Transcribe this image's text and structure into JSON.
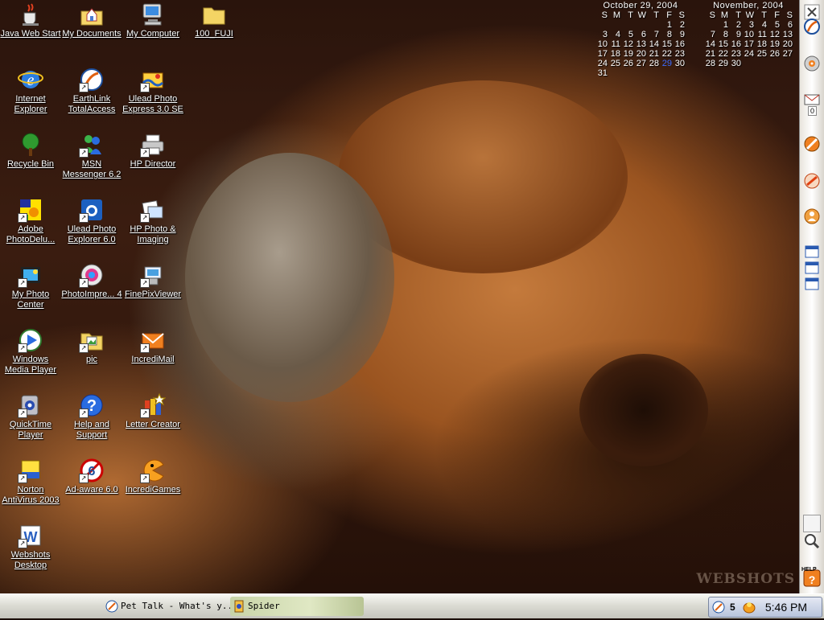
{
  "desktop": {
    "icons": [
      {
        "label": "Java Web Start",
        "icon": "java-cup-icon"
      },
      {
        "label": "My Documents",
        "icon": "house-folder-icon"
      },
      {
        "label": "My Computer",
        "icon": "computer-monitor-icon"
      },
      {
        "label": "100_FUJI",
        "icon": "folder-icon"
      },
      {
        "label": "Internet Explorer",
        "icon": "internet-explorer-icon"
      },
      {
        "label": "EarthLink TotalAccess",
        "icon": "earthlink-icon"
      },
      {
        "label": "Ulead Photo Express 3.0 SE",
        "icon": "photo-express-icon"
      },
      {
        "label": "Recycle Bin",
        "icon": "recycle-bin-tree-icon"
      },
      {
        "label": "MSN Messenger 6.2",
        "icon": "msn-messenger-icon"
      },
      {
        "label": "HP Director",
        "icon": "printer-icon"
      },
      {
        "label": "Adobe PhotoDelu...",
        "icon": "photodeluxe-icon"
      },
      {
        "label": "Ulead Photo Explorer 6.0",
        "icon": "photo-explorer-icon"
      },
      {
        "label": "HP Photo & Imaging",
        "icon": "hp-photo-icon"
      },
      {
        "label": "My Photo Center",
        "icon": "photo-center-icon"
      },
      {
        "label": "PhotoImpre... 4",
        "icon": "photoimpression-icon"
      },
      {
        "label": "FinePixViewer",
        "icon": "finepix-icon"
      },
      {
        "label": "Windows Media Player",
        "icon": "media-player-icon"
      },
      {
        "label": "pic",
        "icon": "picture-folder-icon"
      },
      {
        "label": "IncrediMail",
        "icon": "envelope-icon"
      },
      {
        "label": "QuickTime Player",
        "icon": "quicktime-icon"
      },
      {
        "label": "Help and Support",
        "icon": "help-icon"
      },
      {
        "label": "Letter Creator",
        "icon": "letter-creator-icon"
      },
      {
        "label": "Norton AntiVirus 2003",
        "icon": "norton-icon"
      },
      {
        "label": "Ad-aware 6.0",
        "icon": "ad-aware-icon"
      },
      {
        "label": "IncrediGames",
        "icon": "pacman-icon"
      },
      {
        "label": "Webshots Desktop",
        "icon": "webshots-icon"
      }
    ],
    "watermark": "WEBSHOTS"
  },
  "calendars": [
    {
      "title": "October 29, 2004",
      "weekdays": [
        "S",
        "M",
        "T",
        "W",
        "T",
        "F",
        "S"
      ],
      "weeks": [
        [
          "",
          "",
          "",
          "",
          "",
          "1",
          "2"
        ],
        [
          "3",
          "4",
          "5",
          "6",
          "7",
          "8",
          "9"
        ],
        [
          "10",
          "11",
          "12",
          "13",
          "14",
          "15",
          "16"
        ],
        [
          "17",
          "18",
          "19",
          "20",
          "21",
          "22",
          "23"
        ],
        [
          "24",
          "25",
          "26",
          "27",
          "28",
          "29",
          "30"
        ],
        [
          "31",
          "",
          "",
          "",
          "",
          "",
          ""
        ]
      ],
      "today": "29"
    },
    {
      "title": "November, 2004",
      "weekdays": [
        "S",
        "M",
        "T",
        "W",
        "T",
        "F",
        "S"
      ],
      "weeks": [
        [
          "",
          "1",
          "2",
          "3",
          "4",
          "5",
          "6"
        ],
        [
          "7",
          "8",
          "9",
          "10",
          "11",
          "12",
          "13"
        ],
        [
          "14",
          "15",
          "16",
          "17",
          "18",
          "19",
          "20"
        ],
        [
          "21",
          "22",
          "23",
          "24",
          "25",
          "26",
          "27"
        ],
        [
          "28",
          "29",
          "30",
          "",
          "",
          "",
          ""
        ]
      ],
      "today": ""
    }
  ],
  "toolbar": {
    "items": [
      {
        "icon": "close-icon"
      },
      {
        "icon": "earthlink-icon"
      },
      {
        "icon": "cd-icon"
      },
      {
        "icon": "mail-icon",
        "badge": "0"
      },
      {
        "icon": "no-sign-icon"
      },
      {
        "icon": "earthlink-orange-icon"
      },
      {
        "icon": "user-icon"
      },
      {
        "icon": "window-icon"
      },
      {
        "icon": "window-icon"
      },
      {
        "icon": "window-icon"
      },
      {
        "icon": "search-icon"
      },
      {
        "icon": "help-icon",
        "label": "HELP"
      }
    ]
  },
  "taskbar": {
    "tasks": [
      {
        "label": "Pet Talk - What's y...",
        "icon": "earthlink-icon"
      },
      {
        "label": "Spider",
        "icon": "spider-icon"
      }
    ],
    "tray": {
      "count": "5",
      "clock": "5:46 PM"
    }
  },
  "colors": {
    "label_text": "#ffffff",
    "today": "#3b6cff",
    "taskbar": "#d8d8d0"
  }
}
